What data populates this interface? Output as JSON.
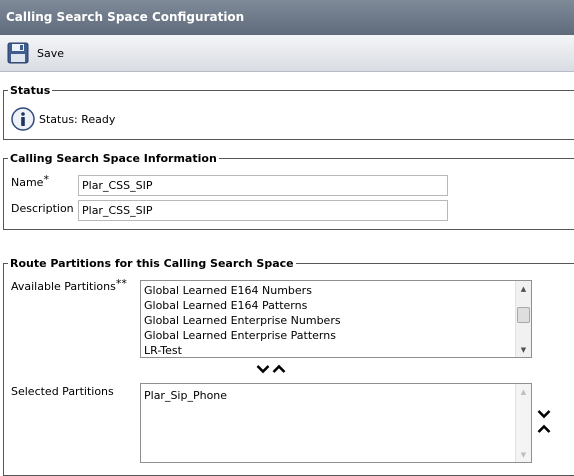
{
  "window": {
    "title": "Calling Search Space Configuration"
  },
  "toolbar": {
    "save_label": "Save",
    "save_icon": "floppy-disk-icon"
  },
  "status": {
    "legend": "Status",
    "text": "Status: Ready",
    "icon": "info-icon"
  },
  "info": {
    "legend": "Calling Search Space Information",
    "name_label": "Name",
    "name_required": "*",
    "name_value": "Plar_CSS_SIP",
    "description_label": "Description",
    "description_value": "Plar_CSS_SIP"
  },
  "partitions": {
    "legend": "Route Partitions for this Calling Search Space",
    "available_label": "Available Partitions",
    "available_required": "**",
    "available_items": [
      "Global Learned E164 Numbers",
      "Global Learned E164 Patterns",
      "Global Learned Enterprise Numbers",
      "Global Learned Enterprise Patterns",
      "LR-Test"
    ],
    "selected_label": "Selected Partitions",
    "selected_items": [
      "Plar_Sip_Phone"
    ]
  },
  "colors": {
    "title_bg": "#6b7685",
    "toolbar_bg": "#e4e7eb",
    "info_icon": "#2d4a7a"
  }
}
